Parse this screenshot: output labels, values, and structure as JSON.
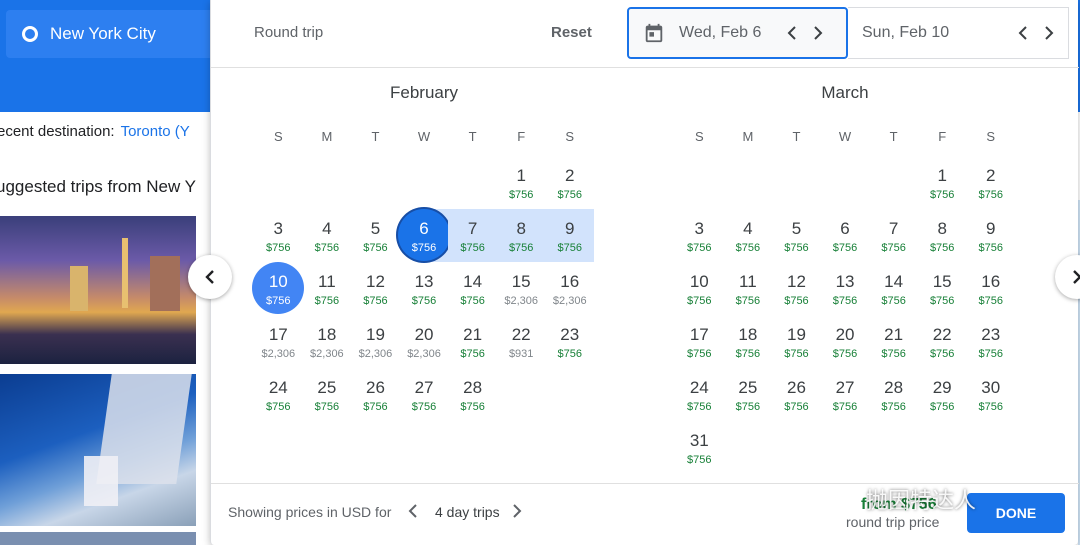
{
  "background": {
    "origin": "New York City",
    "recent_label": "ecent destination:",
    "recent_link": "Toronto (Y",
    "suggested": "uggested trips from New Y"
  },
  "picker": {
    "trip_type": "Round trip",
    "reset": "Reset",
    "depart_date": "Wed, Feb 6",
    "return_date": "Sun, Feb 10",
    "dow": [
      "S",
      "M",
      "T",
      "W",
      "T",
      "F",
      "S"
    ],
    "months": [
      {
        "name": "February",
        "weeks": [
          [
            null,
            null,
            null,
            null,
            null,
            {
              "d": "1",
              "p": "$756"
            },
            {
              "d": "2",
              "p": "$756"
            }
          ],
          [
            {
              "d": "3",
              "p": "$756"
            },
            {
              "d": "4",
              "p": "$756"
            },
            {
              "d": "5",
              "p": "$756"
            },
            {
              "d": "6",
              "p": "$756",
              "s": "dep"
            },
            {
              "d": "7",
              "p": "$756",
              "r": 1
            },
            {
              "d": "8",
              "p": "$756",
              "r": 1
            },
            {
              "d": "9",
              "p": "$756",
              "r": 1
            }
          ],
          [
            {
              "d": "10",
              "p": "$756",
              "s": "ret"
            },
            {
              "d": "11",
              "p": "$756"
            },
            {
              "d": "12",
              "p": "$756"
            },
            {
              "d": "13",
              "p": "$756"
            },
            {
              "d": "14",
              "p": "$756"
            },
            {
              "d": "15",
              "p": "$2,306",
              "h": 1
            },
            {
              "d": "16",
              "p": "$2,306",
              "h": 1
            }
          ],
          [
            {
              "d": "17",
              "p": "$2,306",
              "h": 1
            },
            {
              "d": "18",
              "p": "$2,306",
              "h": 1
            },
            {
              "d": "19",
              "p": "$2,306",
              "h": 1
            },
            {
              "d": "20",
              "p": "$2,306",
              "h": 1
            },
            {
              "d": "21",
              "p": "$756"
            },
            {
              "d": "22",
              "p": "$931",
              "h": 1
            },
            {
              "d": "23",
              "p": "$756"
            }
          ],
          [
            {
              "d": "24",
              "p": "$756"
            },
            {
              "d": "25",
              "p": "$756"
            },
            {
              "d": "26",
              "p": "$756"
            },
            {
              "d": "27",
              "p": "$756"
            },
            {
              "d": "28",
              "p": "$756"
            },
            null,
            null
          ]
        ]
      },
      {
        "name": "March",
        "weeks": [
          [
            null,
            null,
            null,
            null,
            null,
            {
              "d": "1",
              "p": "$756"
            },
            {
              "d": "2",
              "p": "$756"
            }
          ],
          [
            {
              "d": "3",
              "p": "$756"
            },
            {
              "d": "4",
              "p": "$756"
            },
            {
              "d": "5",
              "p": "$756"
            },
            {
              "d": "6",
              "p": "$756"
            },
            {
              "d": "7",
              "p": "$756"
            },
            {
              "d": "8",
              "p": "$756"
            },
            {
              "d": "9",
              "p": "$756"
            }
          ],
          [
            {
              "d": "10",
              "p": "$756"
            },
            {
              "d": "11",
              "p": "$756"
            },
            {
              "d": "12",
              "p": "$756"
            },
            {
              "d": "13",
              "p": "$756"
            },
            {
              "d": "14",
              "p": "$756"
            },
            {
              "d": "15",
              "p": "$756"
            },
            {
              "d": "16",
              "p": "$756"
            }
          ],
          [
            {
              "d": "17",
              "p": "$756"
            },
            {
              "d": "18",
              "p": "$756"
            },
            {
              "d": "19",
              "p": "$756"
            },
            {
              "d": "20",
              "p": "$756"
            },
            {
              "d": "21",
              "p": "$756"
            },
            {
              "d": "22",
              "p": "$756"
            },
            {
              "d": "23",
              "p": "$756"
            }
          ],
          [
            {
              "d": "24",
              "p": "$756"
            },
            {
              "d": "25",
              "p": "$756"
            },
            {
              "d": "26",
              "p": "$756"
            },
            {
              "d": "27",
              "p": "$756"
            },
            {
              "d": "28",
              "p": "$756"
            },
            {
              "d": "29",
              "p": "$756"
            },
            {
              "d": "30",
              "p": "$756"
            }
          ],
          [
            {
              "d": "31",
              "p": "$756"
            },
            null,
            null,
            null,
            null,
            null,
            null
          ]
        ]
      }
    ],
    "footer": {
      "showing": "Showing prices in USD for",
      "trip_length": "4 day trips",
      "price_partial": "from $756",
      "price_sub": "round trip price",
      "done": "DONE"
    },
    "watermark": "抛因特达人"
  },
  "colors": {
    "accent": "#1a73e8",
    "price_low": "#188038",
    "price_high": "#80868b",
    "range": "#d2e3fc"
  }
}
